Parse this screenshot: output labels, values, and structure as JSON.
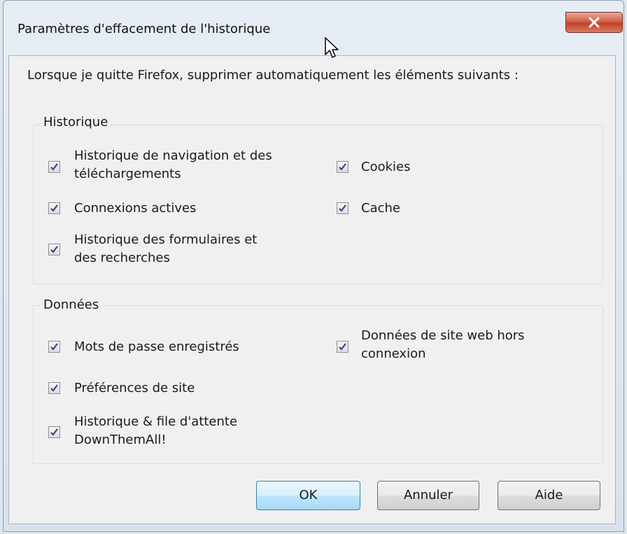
{
  "window": {
    "title": "Paramètres d'effacement de l'historique"
  },
  "description": "Lorsque je quitte Firefox, supprimer automatiquement les éléments suivants :",
  "groups": {
    "historique": {
      "label": "Historique",
      "items": [
        {
          "line1": "Historique de navigation et des",
          "line2": "téléchargements",
          "checked": true
        },
        {
          "label": "Cookies",
          "checked": true
        },
        {
          "label": "Connexions actives",
          "checked": true
        },
        {
          "label": "Cache",
          "checked": true
        },
        {
          "line1": "Historique des formulaires et",
          "line2": "des recherches",
          "checked": true
        }
      ]
    },
    "donnees": {
      "label": "Données",
      "items": [
        {
          "label": "Mots de passe enregistrés",
          "checked": true
        },
        {
          "line1": "Données de site web hors",
          "line2": "connexion",
          "checked": true
        },
        {
          "label": "Préférences de site",
          "checked": true
        },
        {
          "line1": "Historique & file d'attente",
          "line2": "DownThemAll!",
          "checked": true
        }
      ]
    }
  },
  "buttons": {
    "ok": "OK",
    "cancel": "Annuler",
    "help": "Aide"
  },
  "colors": {
    "close_button": "#c9472e",
    "default_button_border": "#3c7fb1",
    "check_mark": "#2e4a8a"
  }
}
